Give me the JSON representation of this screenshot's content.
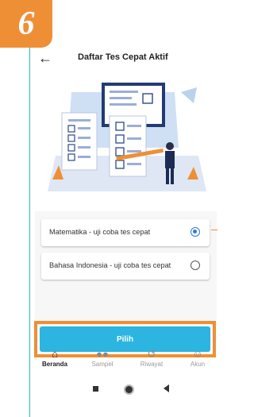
{
  "step_badge": "6",
  "header": {
    "back_icon": "arrow-left-icon",
    "title": "Daftar Tes Cepat Aktif"
  },
  "options": [
    {
      "label": "Matematika - uji coba tes cepat",
      "selected": true
    },
    {
      "label": "Bahasa Indonesia - uji coba tes cepat",
      "selected": false
    }
  ],
  "submit_label": "Pilih",
  "bottom_nav": [
    {
      "label": "Beranda",
      "icon": "home-icon",
      "active": true
    },
    {
      "label": "Sampel",
      "icon": "people-icon",
      "active": false
    },
    {
      "label": "Riwayat",
      "icon": "history-icon",
      "active": false
    },
    {
      "label": "Akun",
      "icon": "account-icon",
      "active": false
    }
  ],
  "colors": {
    "accent": "#ef8f35",
    "button": "#2cb5e0",
    "radio": "#2a7bdc",
    "frame": "#2fb9b0"
  }
}
